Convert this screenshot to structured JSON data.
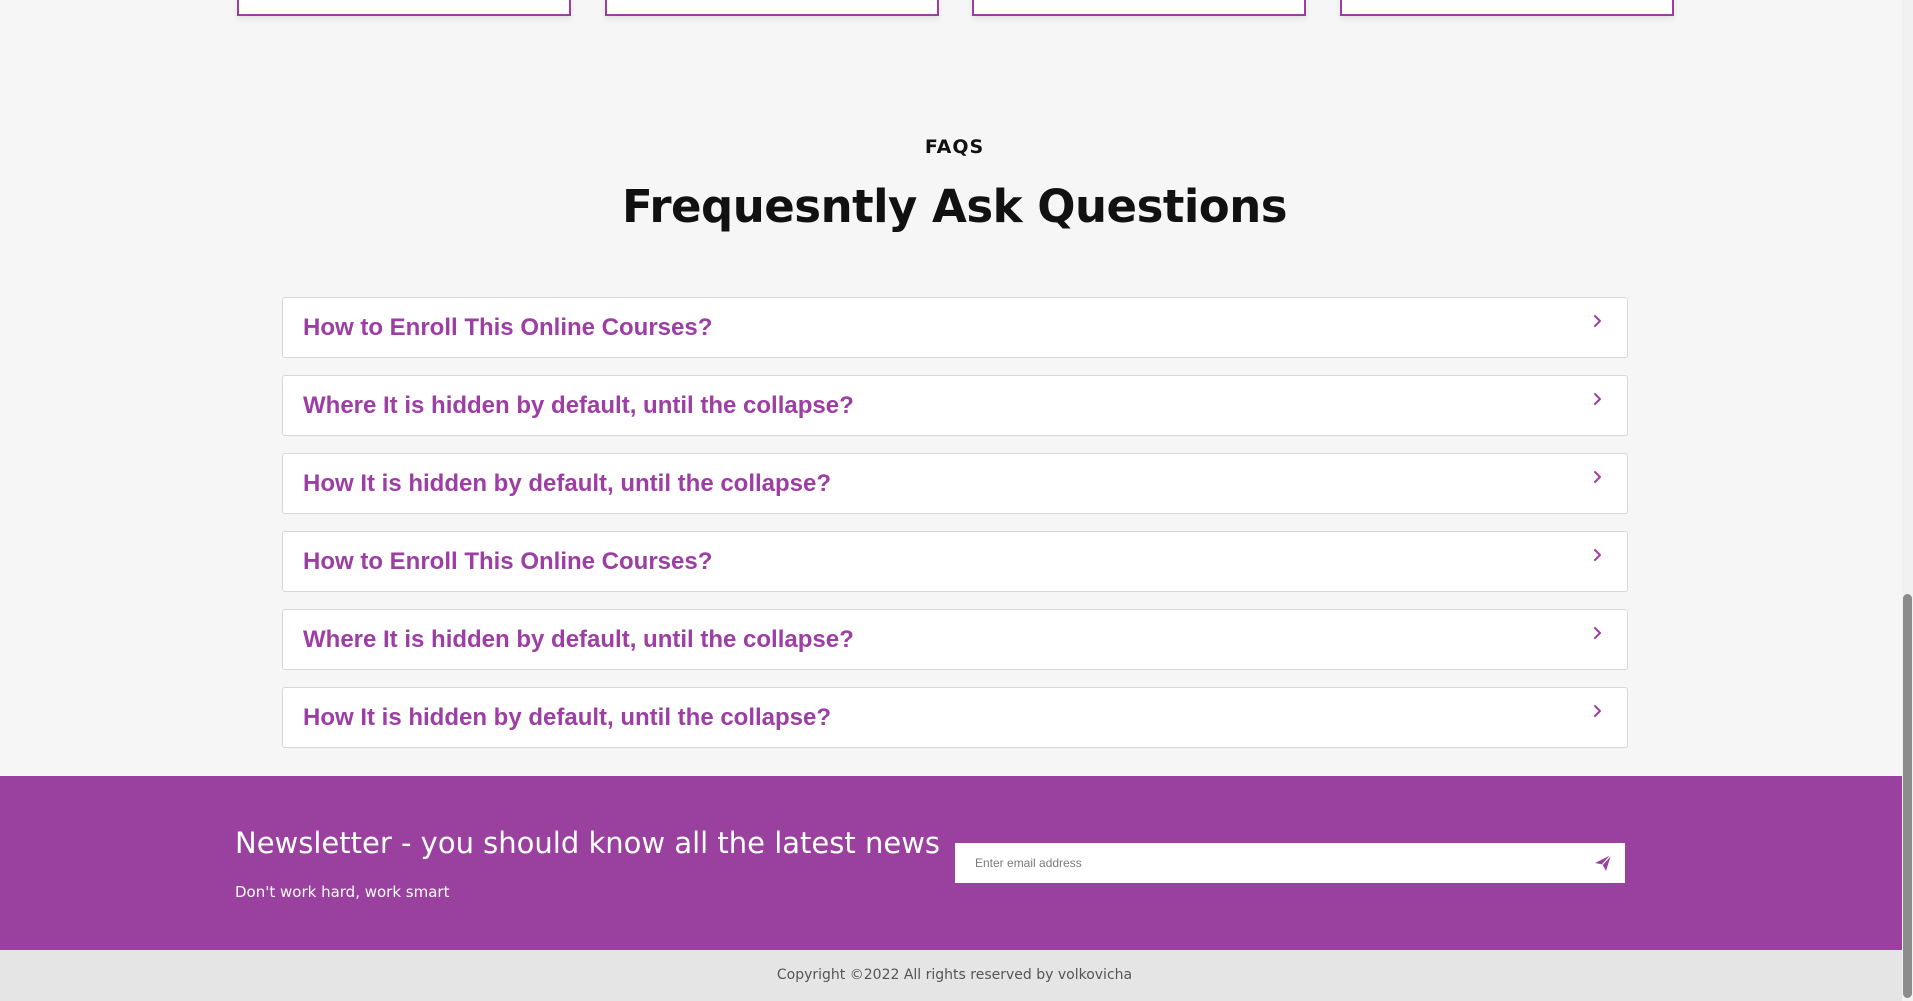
{
  "faq_section": {
    "kicker": "FAQS",
    "title": "Frequesntly Ask Questions",
    "items": [
      {
        "question": "How to Enroll This Online Courses?"
      },
      {
        "question": "Where It is hidden by default, until the collapse?"
      },
      {
        "question": "How It is hidden by default, until the collapse?"
      },
      {
        "question": "How to Enroll This Online Courses?"
      },
      {
        "question": "Where It is hidden by default, until the collapse?"
      },
      {
        "question": "How It is hidden by default, until the collapse?"
      }
    ]
  },
  "newsletter": {
    "title": "Newsletter - you should know all the latest news",
    "subtitle": "Don't work hard, work smart",
    "email_placeholder": "Enter email address",
    "send_icon": "paper-plane-icon"
  },
  "footer": {
    "copyright": "Copyright ©2022 All rights reserved by volkovicha"
  },
  "colors": {
    "accent": "#9a409f",
    "question_text": "#9c3ea3",
    "footer_bg": "#e5e5e5",
    "page_bg": "#f6f6f6"
  }
}
